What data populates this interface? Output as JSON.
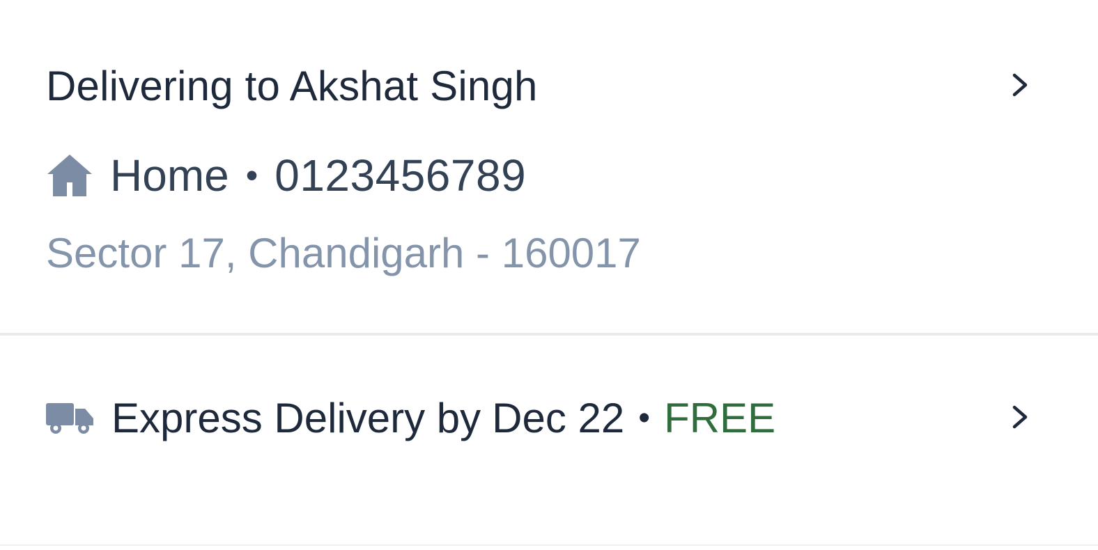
{
  "address": {
    "title": "Delivering to Akshat Singh",
    "label": "Home",
    "separator": "•",
    "phone": "0123456789",
    "line": "Sector 17, Chandigarh - 160017",
    "icon": "home-icon",
    "chevron": "chevron-right-icon"
  },
  "delivery": {
    "text": "Express Delivery by",
    "date": "Dec 22",
    "separator": "•",
    "price": "FREE",
    "icon": "truck-icon",
    "chevron": "chevron-right-icon"
  },
  "colors": {
    "title": "#1e293b",
    "secondary": "#334155",
    "muted": "#8494aa",
    "icon": "#7c8ca4",
    "free": "#2f6e3c",
    "divider": "#e6ebf0"
  }
}
